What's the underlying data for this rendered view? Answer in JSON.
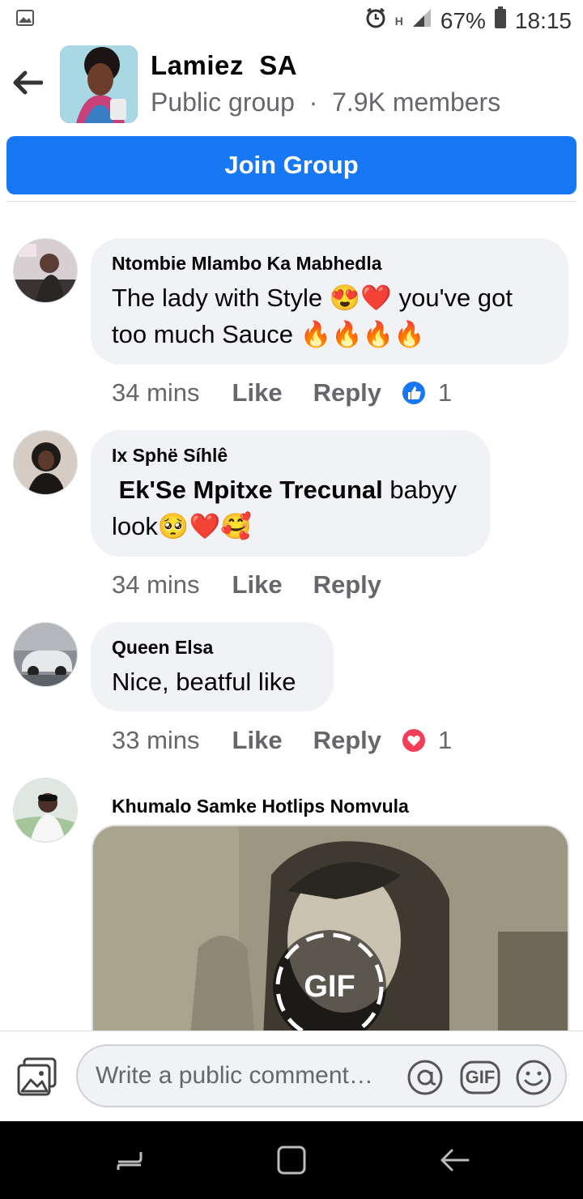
{
  "status_bar": {
    "battery": "67%",
    "time": "18:15",
    "signal_label": "H"
  },
  "header": {
    "group_name": "Lamiez  SA",
    "group_type": "Public group",
    "separator": "·",
    "members": "7.9K members"
  },
  "join_button": {
    "label": "Join Group"
  },
  "comments": [
    {
      "author": "Ntombie Mlambo Ka Mabhedla",
      "text_line1": "The lady with Style 😍❤️ you've got",
      "text_line2": "too much Sauce 🔥🔥🔥🔥",
      "time": "34 mins",
      "like_label": "Like",
      "reply_label": "Reply",
      "reaction": "like",
      "reaction_count": "1"
    },
    {
      "author": "Ix Sphë Síhlê",
      "mention": "Ek'Se Mpitxe Trecunal",
      "text_after_mention": " babyy",
      "text_line2": "look🥺❤️🥰",
      "time": "34 mins",
      "like_label": "Like",
      "reply_label": "Reply"
    },
    {
      "author": "Queen Elsa",
      "text_line1": "Nice, beatful like",
      "time": "33 mins",
      "like_label": "Like",
      "reply_label": "Reply",
      "reaction": "love",
      "reaction_count": "1"
    },
    {
      "author": "Khumalo Samke Hotlips Nomvula",
      "gif_label": "GIF"
    }
  ],
  "composer": {
    "placeholder": "Write a public comment…",
    "gif_label": "GIF"
  },
  "colors": {
    "accent": "#1877f2",
    "bubble": "#f0f2f5",
    "secondary_text": "#65676b",
    "love": "#f33e58"
  }
}
